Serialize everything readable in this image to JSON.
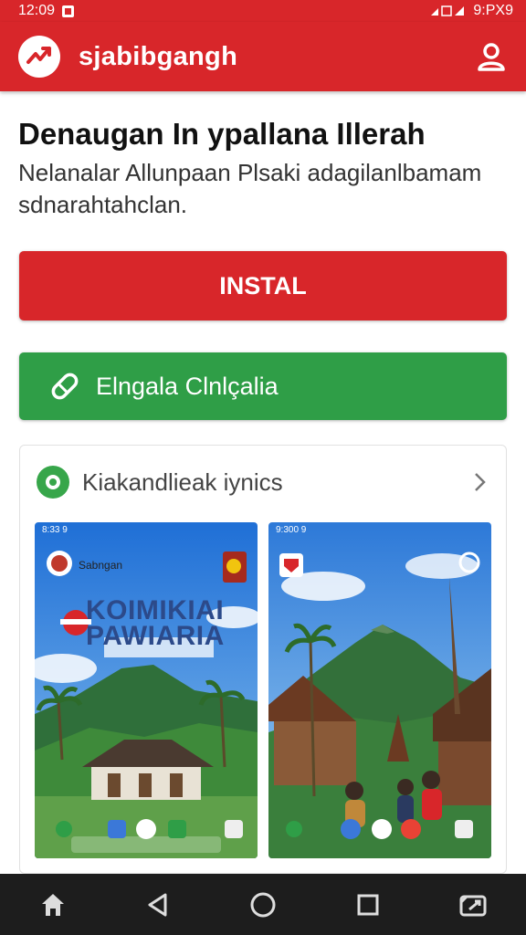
{
  "status_bar": {
    "time": "12:09",
    "right_text": "9:PX9",
    "icons": [
      "notification-icon",
      "signal-icon",
      "battery-icon"
    ]
  },
  "app_bar": {
    "title": "sjabibgangh",
    "logo_icon": "chart-trend-icon",
    "profile_icon": "user-icon"
  },
  "content": {
    "headline": "Denaugan In ypallana Illerah",
    "description": "Nelanalar Allunpaan Plsaki adagilanlbamam sdnarahtahclan."
  },
  "buttons": {
    "install_label": "INSTAL",
    "secondary_label": "Elngala Clnlçalia",
    "secondary_icon": "link-icon"
  },
  "card": {
    "title": "Kiakandlieak iynics",
    "icon": "chat-icon",
    "chevron_icon": "chevron-right-icon",
    "screenshots": [
      {
        "status": "8:33 9",
        "label": "Sabngan",
        "banner_line1": "KOIMIKIAI",
        "banner_line2": "PAWIARIA"
      },
      {
        "status": "9:300 9"
      }
    ]
  },
  "colors": {
    "primary": "#d8262a",
    "secondary": "#2f9e47",
    "nav": "#1d1d1d"
  },
  "nav_bar": {
    "items": [
      "home-icon",
      "back-icon",
      "home-circle-icon",
      "recents-icon",
      "screenshot-icon"
    ]
  }
}
